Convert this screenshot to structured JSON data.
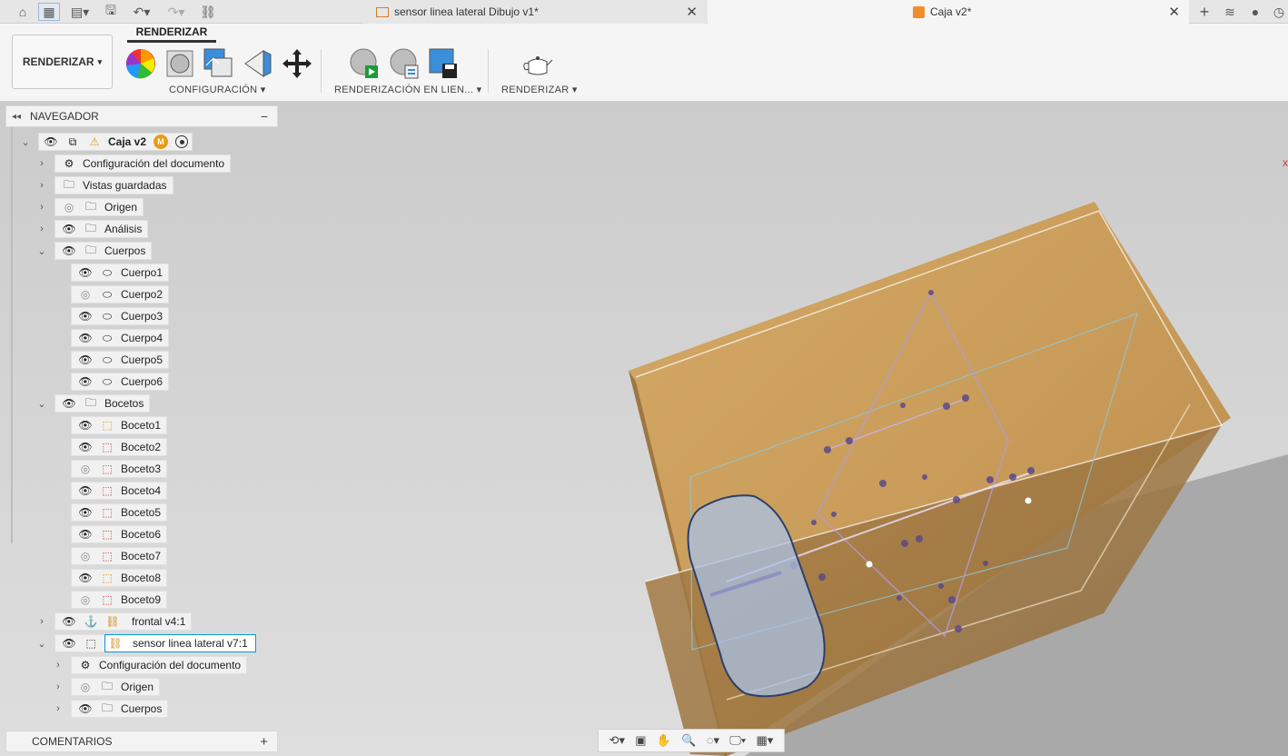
{
  "tabs": [
    {
      "label": "sensor linea lateral Dibujo v1*",
      "active": false
    },
    {
      "label": "Caja v2*",
      "active": true
    }
  ],
  "ribbon": {
    "workspace_label": "RENDERIZAR",
    "active_tab": "RENDERIZAR",
    "groups": {
      "config": "CONFIGURACIÓN",
      "inline": "RENDERIZACIÓN EN LIEN...",
      "render": "RENDERIZAR"
    }
  },
  "navigator": {
    "title": "NAVEGADOR",
    "root": "Caja v2",
    "items": [
      {
        "label": "Configuración del documento",
        "icon": "gear-icon"
      },
      {
        "label": "Vistas guardadas",
        "icon": "folder-icon"
      },
      {
        "label": "Origen",
        "icon": "folder-icon"
      },
      {
        "label": "Análisis",
        "icon": "folder-icon"
      },
      {
        "label": "Cuerpos",
        "icon": "folder-icon"
      },
      {
        "label": "Cuerpo1"
      },
      {
        "label": "Cuerpo2"
      },
      {
        "label": "Cuerpo3"
      },
      {
        "label": "Cuerpo4"
      },
      {
        "label": "Cuerpo5"
      },
      {
        "label": "Cuerpo6"
      },
      {
        "label": "Bocetos",
        "icon": "folder-icon"
      },
      {
        "label": "Boceto1"
      },
      {
        "label": "Boceto2"
      },
      {
        "label": "Boceto3"
      },
      {
        "label": "Boceto4"
      },
      {
        "label": "Boceto5"
      },
      {
        "label": "Boceto6"
      },
      {
        "label": "Boceto7"
      },
      {
        "label": "Boceto8"
      },
      {
        "label": "Boceto9"
      },
      {
        "label": "frontal v4:1"
      },
      {
        "label": "sensor linea lateral v7:1"
      },
      {
        "label": "Configuración del documento"
      },
      {
        "label": "Origen"
      },
      {
        "label": "Cuerpos"
      }
    ]
  },
  "comments": {
    "title": "COMENTARIOS"
  },
  "colors": {
    "accent": "#0696d7",
    "wood": "#c49a5c",
    "ribbon_bg": "#f5f5f5"
  }
}
